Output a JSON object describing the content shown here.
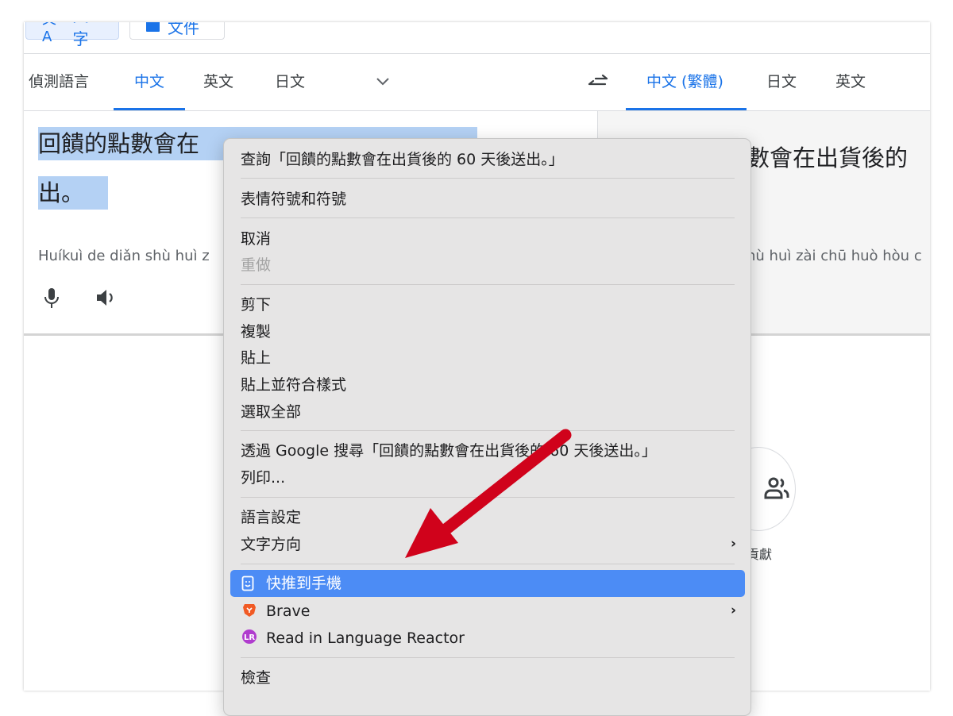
{
  "toolbar": {
    "text_mode": "文字",
    "docs_mode": "文件"
  },
  "source_langs": {
    "detect": "偵測語言",
    "zh": "中文",
    "en": "英文",
    "ja": "日文"
  },
  "target_langs": {
    "zh_tw": "中文 (繁體)",
    "ja": "日文",
    "en": "英文"
  },
  "source": {
    "text_line1": "回饋的點數會在",
    "text_line2": "出。",
    "romanization": "Huíkuì de diǎn shù huì z"
  },
  "target": {
    "text": "數會在出貨後的",
    "romanization": "hù huì zài chū huò hòu c"
  },
  "contribute": {
    "label": "貢獻"
  },
  "context_menu": {
    "lookup": "查詢「回饋的點數會在出貨後的 60 天後送出。」",
    "emoji": "表情符號和符號",
    "undo": "取消",
    "redo": "重做",
    "cut": "剪下",
    "copy": "複製",
    "paste": "貼上",
    "paste_match": "貼上並符合樣式",
    "select_all": "選取全部",
    "search_google": "透過 Google 搜尋「回饋的點數會在出貨後的 60 天後送出。」",
    "print": "列印...",
    "lang_settings": "語言設定",
    "writing_direction": "文字方向",
    "push_to_phone": "快推到手機",
    "brave": "Brave",
    "language_reactor": "Read in Language Reactor",
    "inspect": "檢查"
  },
  "colors": {
    "accent": "#1a73e8",
    "selection": "#4c8cf5",
    "highlight": "#b4d1f4",
    "arrow": "#d0021b"
  }
}
